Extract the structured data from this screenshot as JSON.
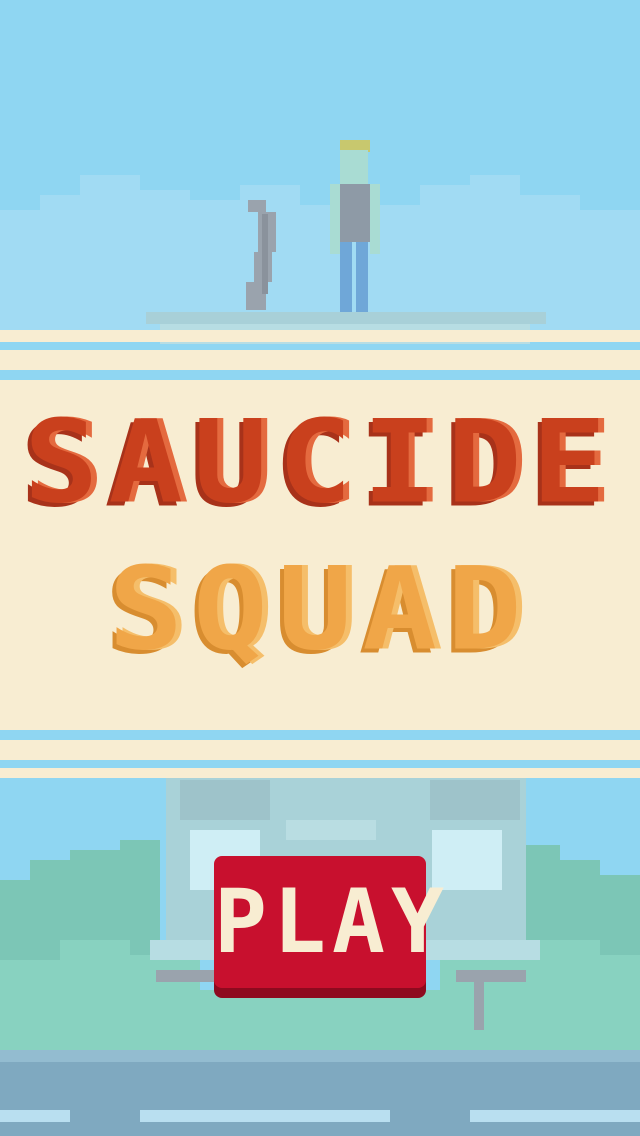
{
  "game": {
    "title_line_1": "SAUCIDE",
    "title_line_2": "SQUAD",
    "play_label": "PLAY"
  },
  "colors": {
    "sky": "#8fd6f2",
    "cream": "#f8edd2",
    "title_red": "#c9401d",
    "title_orange": "#f0a648",
    "play_button": "#c8102e",
    "road": "#7fa9c0"
  },
  "icons": [
    "character-sprite",
    "sausage-sprite",
    "building-sprite",
    "road"
  ]
}
